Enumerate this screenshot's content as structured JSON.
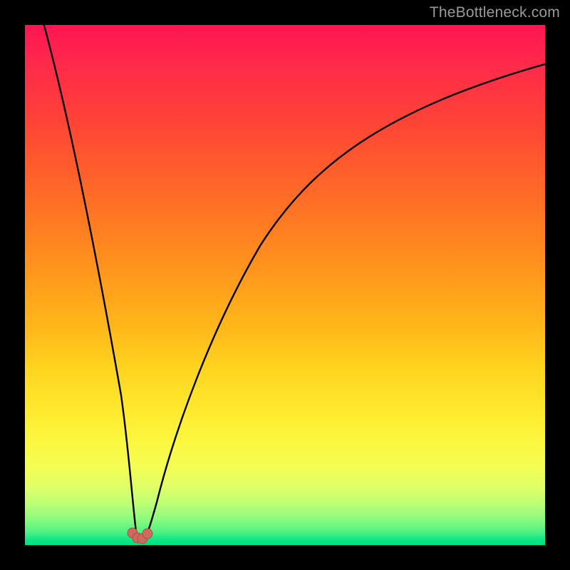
{
  "watermark": "TheBottleneck.com",
  "colors": {
    "frame": "#000000",
    "curve_stroke": "#000000",
    "marker_fill": "#d06a5f",
    "marker_stroke": "#a84f46",
    "gradient_top": "#ff1552",
    "gradient_bottom": "#00e085"
  },
  "chart_data": {
    "type": "line",
    "title": "",
    "xlabel": "",
    "ylabel": "",
    "xlim": [
      0,
      100
    ],
    "ylim": [
      0,
      100
    ],
    "grid": false,
    "legend": false,
    "notes": "Background is a vertical heat gradient from red (top, high bottleneck) to green (bottom, low bottleneck). The black curve is a V-shape with its minimum near x≈22. Small rounded markers sit at the valley floor.",
    "series": [
      {
        "name": "bottleneck-curve",
        "x": [
          0,
          3,
          6,
          9,
          12,
          15,
          18,
          20,
          21,
          22,
          23,
          24,
          26,
          30,
          35,
          40,
          45,
          50,
          55,
          60,
          65,
          70,
          75,
          80,
          85,
          90,
          95,
          100
        ],
        "y": [
          100,
          86,
          72,
          58,
          45,
          32,
          18,
          7,
          3,
          1,
          2,
          5,
          12,
          25,
          38,
          48,
          56,
          62,
          67,
          71,
          74,
          77,
          79,
          81,
          83,
          84,
          85.5,
          87
        ]
      }
    ],
    "markers": {
      "name": "valley-markers",
      "x": [
        20.8,
        21.6,
        22.4,
        23.2
      ],
      "y": [
        2.2,
        1.1,
        1.0,
        2.0
      ]
    }
  }
}
